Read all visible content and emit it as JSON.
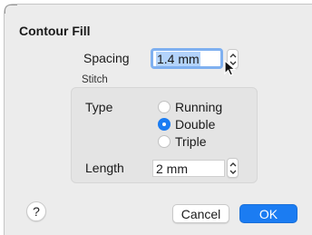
{
  "dialog": {
    "title": "Contour Fill",
    "spacing": {
      "label": "Spacing",
      "value_selected": "1.4 mm"
    },
    "stitch_group": {
      "label": "Stitch",
      "type_label": "Type",
      "options": [
        {
          "label": "Running",
          "selected": false
        },
        {
          "label": "Double",
          "selected": true
        },
        {
          "label": "Triple",
          "selected": false
        }
      ],
      "length_label": "Length",
      "length_value": "2 mm"
    },
    "buttons": {
      "help": "?",
      "cancel": "Cancel",
      "ok": "OK"
    }
  },
  "icons": {
    "stepper": "stepper-icon",
    "cursor": "arrow-cursor-icon"
  },
  "colors": {
    "accent": "#1b7cf2",
    "selection": "#b3d3fb",
    "focus_ring": "#7fb0f0"
  }
}
